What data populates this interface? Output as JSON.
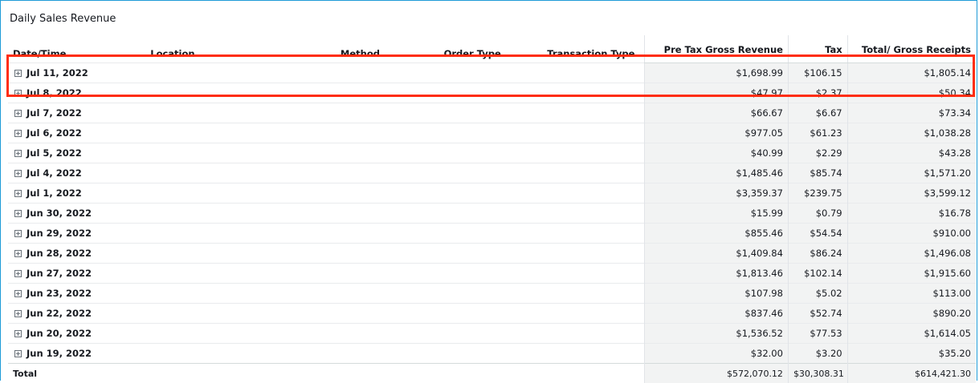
{
  "title": "Daily Sales Revenue",
  "columns": {
    "date": "Date/Time",
    "location": "Location",
    "method": "Method",
    "order_type": "Order Type",
    "transaction_type": "Transaction Type",
    "pre_tax": "Pre Tax Gross Revenue",
    "tax": "Tax",
    "total": "Total/ Gross Receipts"
  },
  "rows": [
    {
      "date": "Jul 11, 2022",
      "pre_tax": "$1,698.99",
      "tax": "$106.15",
      "total": "$1,805.14"
    },
    {
      "date": "Jul 8, 2022",
      "pre_tax": "$47.97",
      "tax": "$2.37",
      "total": "$50.34"
    },
    {
      "date": "Jul 7, 2022",
      "pre_tax": "$66.67",
      "tax": "$6.67",
      "total": "$73.34"
    },
    {
      "date": "Jul 6, 2022",
      "pre_tax": "$977.05",
      "tax": "$61.23",
      "total": "$1,038.28"
    },
    {
      "date": "Jul 5, 2022",
      "pre_tax": "$40.99",
      "tax": "$2.29",
      "total": "$43.28"
    },
    {
      "date": "Jul 4, 2022",
      "pre_tax": "$1,485.46",
      "tax": "$85.74",
      "total": "$1,571.20"
    },
    {
      "date": "Jul 1, 2022",
      "pre_tax": "$3,359.37",
      "tax": "$239.75",
      "total": "$3,599.12"
    },
    {
      "date": "Jun 30, 2022",
      "pre_tax": "$15.99",
      "tax": "$0.79",
      "total": "$16.78"
    },
    {
      "date": "Jun 29, 2022",
      "pre_tax": "$855.46",
      "tax": "$54.54",
      "total": "$910.00"
    },
    {
      "date": "Jun 28, 2022",
      "pre_tax": "$1,409.84",
      "tax": "$86.24",
      "total": "$1,496.08"
    },
    {
      "date": "Jun 27, 2022",
      "pre_tax": "$1,813.46",
      "tax": "$102.14",
      "total": "$1,915.60"
    },
    {
      "date": "Jun 23, 2022",
      "pre_tax": "$107.98",
      "tax": "$5.02",
      "total": "$113.00"
    },
    {
      "date": "Jun 22, 2022",
      "pre_tax": "$837.46",
      "tax": "$52.74",
      "total": "$890.20"
    },
    {
      "date": "Jun 20, 2022",
      "pre_tax": "$1,536.52",
      "tax": "$77.53",
      "total": "$1,614.05"
    },
    {
      "date": "Jun 19, 2022",
      "pre_tax": "$32.00",
      "tax": "$3.20",
      "total": "$35.20"
    }
  ],
  "total_row": {
    "label": "Total",
    "pre_tax": "$572,070.12",
    "tax": "$30,308.31",
    "total": "$614,421.30"
  },
  "highlighted_rows": [
    "Jul 11, 2022",
    "Jul 8, 2022"
  ],
  "colors": {
    "highlight_border": "#ff2d10",
    "frame_border": "#1e9bd7",
    "numeric_cell_bg": "#f2f3f3"
  },
  "icons": {
    "row_expander": "plus-square-icon"
  }
}
